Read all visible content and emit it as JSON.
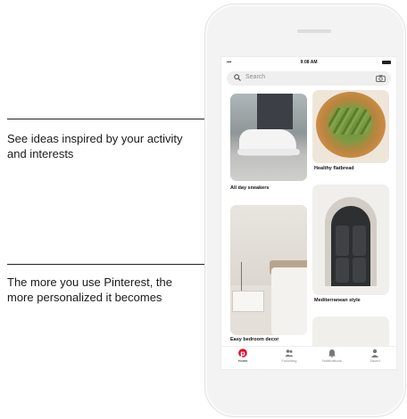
{
  "callouts": [
    {
      "text": "See ideas inspired by your activity and interests"
    },
    {
      "text": "The more you use Pinterest, the more personalized it becomes"
    }
  ],
  "status_bar": {
    "time": "9:08 AM"
  },
  "search": {
    "placeholder": "Search"
  },
  "pins": [
    {
      "caption": "All day sneakers"
    },
    {
      "caption": "Healthy flatbread"
    },
    {
      "caption": "Mediterranean style"
    },
    {
      "caption": "Easy bedroom decor"
    }
  ],
  "nav": [
    {
      "label": "Home",
      "icon": "pinterest-logo-icon",
      "active": true
    },
    {
      "label": "Following",
      "icon": "people-icon",
      "active": false
    },
    {
      "label": "Notifications",
      "icon": "bell-icon",
      "active": false
    },
    {
      "label": "Saved",
      "icon": "person-icon",
      "active": false
    }
  ],
  "colors": {
    "brand": "#e60023",
    "search_bg": "#efefef"
  }
}
